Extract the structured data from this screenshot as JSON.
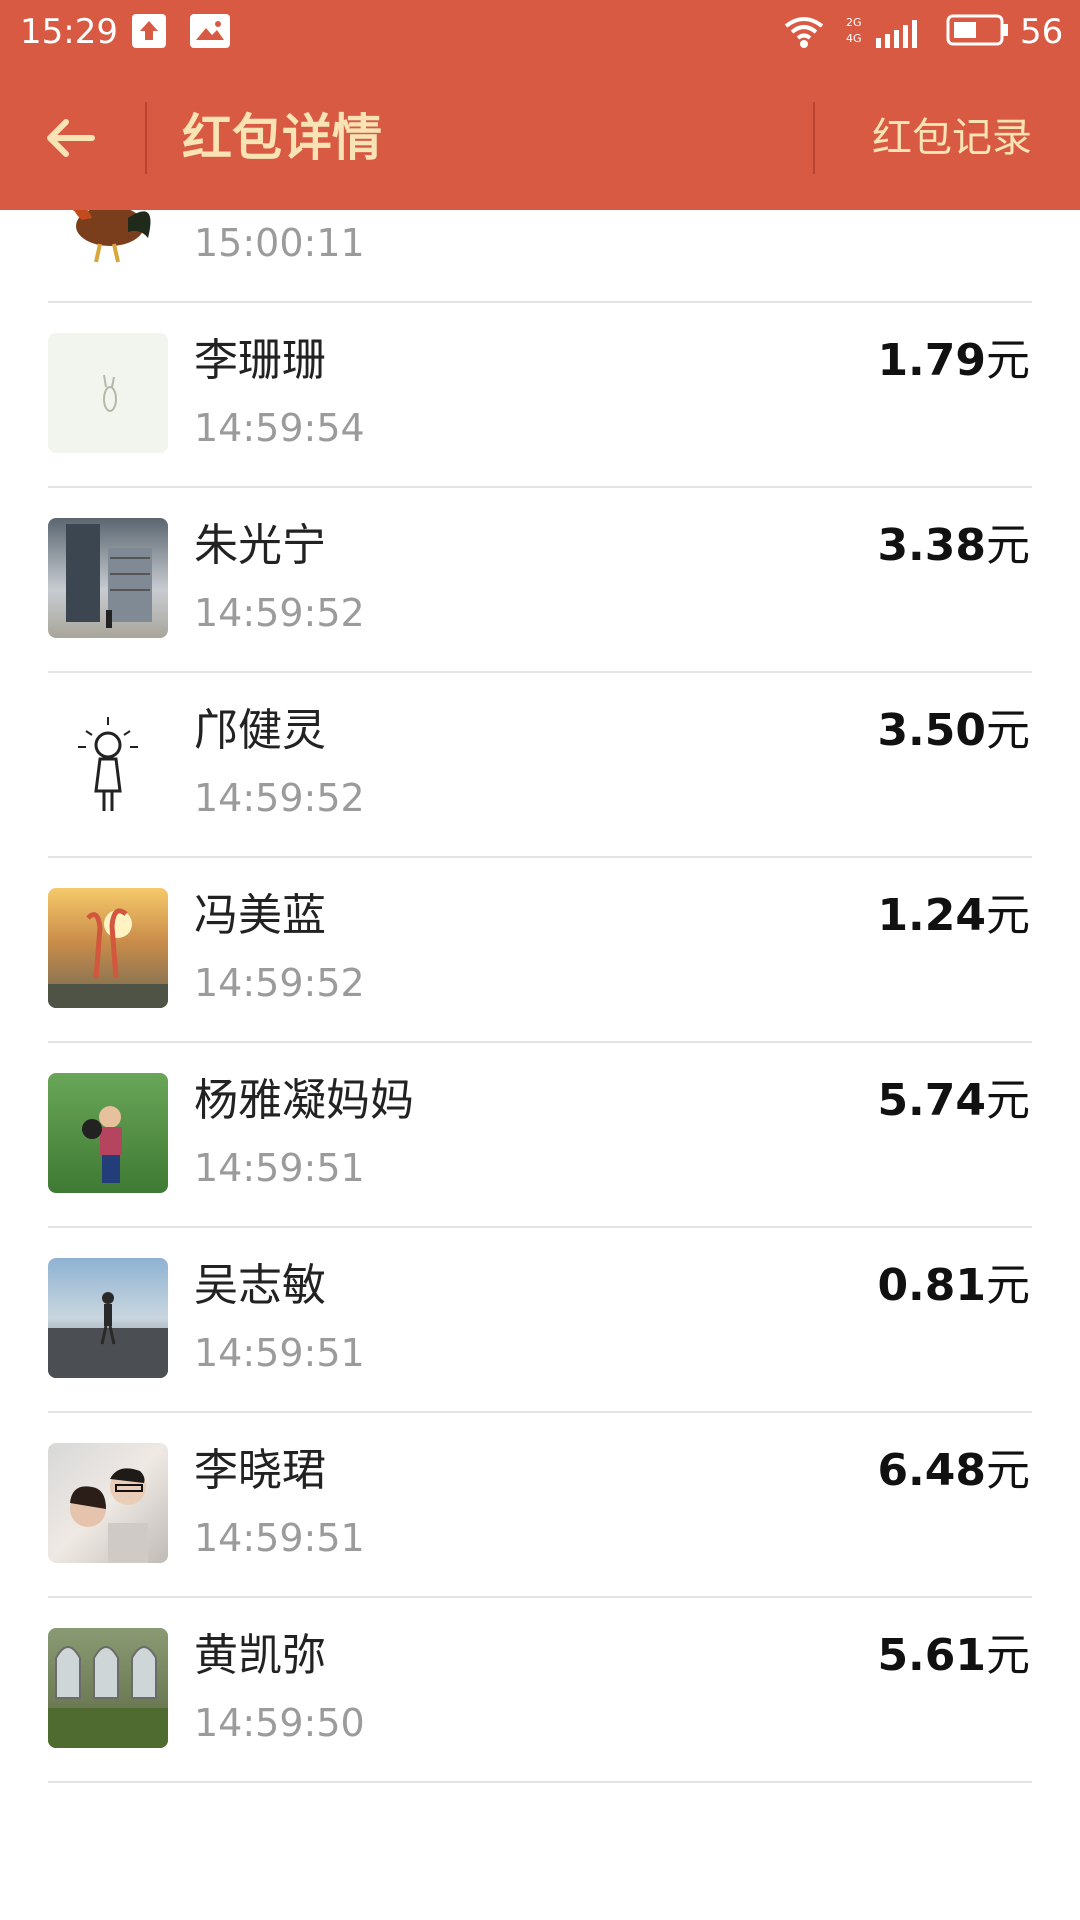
{
  "status_bar": {
    "time": "15:29",
    "network_label_top": "2G",
    "network_label_bottom": "4G",
    "battery_percent": "56",
    "icons": [
      "upload-icon",
      "photo-icon",
      "wifi-icon",
      "signal-icon",
      "battery-icon"
    ]
  },
  "header": {
    "title": "红包详情",
    "record_label": "红包记录",
    "back_icon": "arrow-left-icon",
    "background": "#D85A42",
    "text_color": "#F8E3B4"
  },
  "list": {
    "partial_row": {
      "time": "15:00:11",
      "avatar": "rooster"
    },
    "unit": "元",
    "items": [
      {
        "name": "李珊珊",
        "time": "14:59:54",
        "amount": "1.79",
        "avatar": "sketch-rabbit"
      },
      {
        "name": "朱光宁",
        "time": "14:59:52",
        "amount": "3.38",
        "avatar": "building"
      },
      {
        "name": "邝健灵",
        "time": "14:59:52",
        "amount": "3.50",
        "avatar": "cartoon-girl"
      },
      {
        "name": "冯美蓝",
        "time": "14:59:52",
        "amount": "1.24",
        "avatar": "flamingos-sunset"
      },
      {
        "name": "杨雅凝妈妈",
        "time": "14:59:51",
        "amount": "5.74",
        "avatar": "child-on-grass"
      },
      {
        "name": "吴志敏",
        "time": "14:59:51",
        "amount": "0.81",
        "avatar": "beach-person"
      },
      {
        "name": "李晓珺",
        "time": "14:59:51",
        "amount": "6.48",
        "avatar": "couple-selfie"
      },
      {
        "name": "黄凯弥",
        "time": "14:59:50",
        "amount": "5.61",
        "avatar": "garden-house"
      }
    ]
  }
}
